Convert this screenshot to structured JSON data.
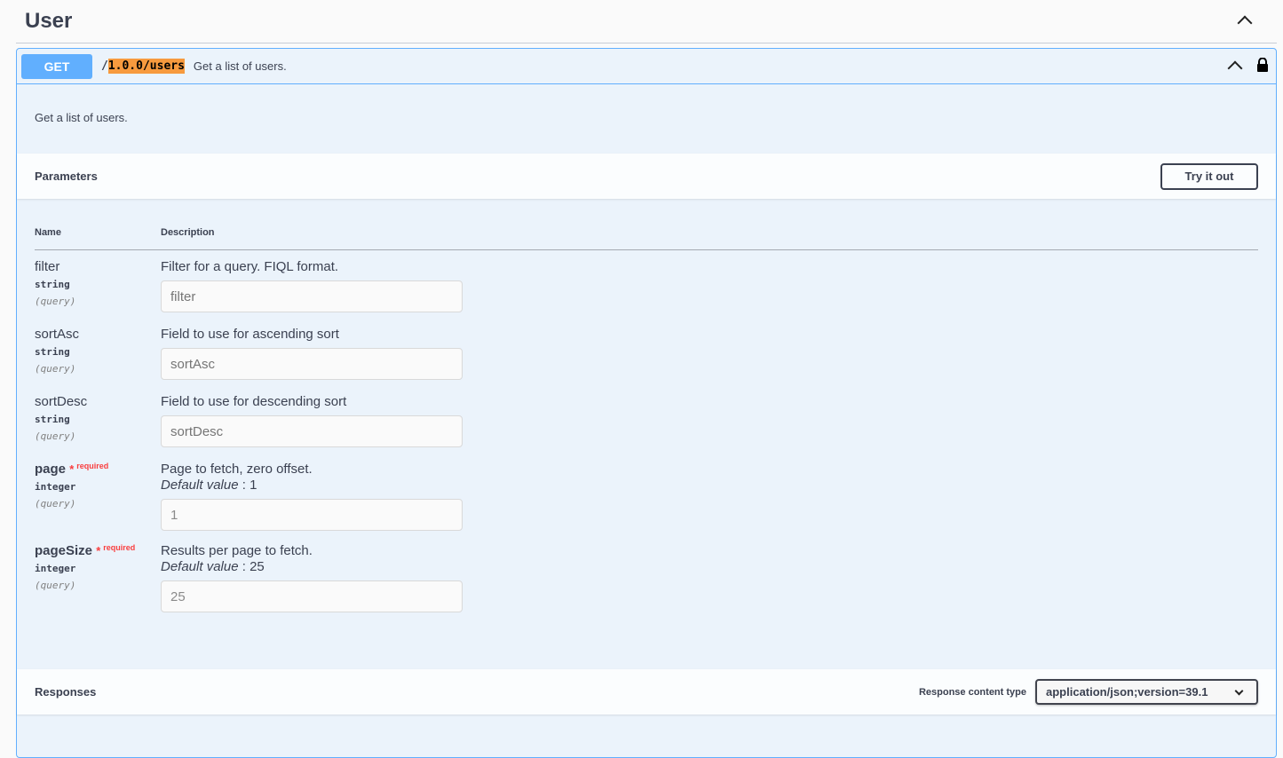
{
  "tag": {
    "title": "User"
  },
  "operation": {
    "method": "GET",
    "path_prefix": "/",
    "path_highlight": "1.0.0/users",
    "summary": "Get a list of users.",
    "description": "Get a list of users."
  },
  "parameters": {
    "title": "Parameters",
    "try_label": "Try it out",
    "col_name": "Name",
    "col_description": "Description",
    "items": [
      {
        "name": "filter",
        "type": "string",
        "in": "(query)",
        "description": "Filter for a query. FIQL format.",
        "placeholder": "filter",
        "value": ""
      },
      {
        "name": "sortAsc",
        "type": "string",
        "in": "(query)",
        "description": "Field to use for ascending sort",
        "placeholder": "sortAsc",
        "value": ""
      },
      {
        "name": "sortDesc",
        "type": "string",
        "in": "(query)",
        "description": "Field to use for descending sort",
        "placeholder": "sortDesc",
        "value": ""
      },
      {
        "name": "page",
        "star": "*",
        "required": "required",
        "type": "integer",
        "in": "(query)",
        "description": "Page to fetch, zero offset.",
        "default_label": "Default value",
        "default": " : 1",
        "value": "1"
      },
      {
        "name": "pageSize",
        "star": "*",
        "required": "required",
        "type": "integer",
        "in": "(query)",
        "description": "Results per page to fetch.",
        "default_label": "Default value",
        "default": " : 25",
        "value": "25"
      }
    ]
  },
  "responses": {
    "title": "Responses",
    "content_type_label": "Response content type",
    "content_type": "application/json;version=39.1"
  }
}
